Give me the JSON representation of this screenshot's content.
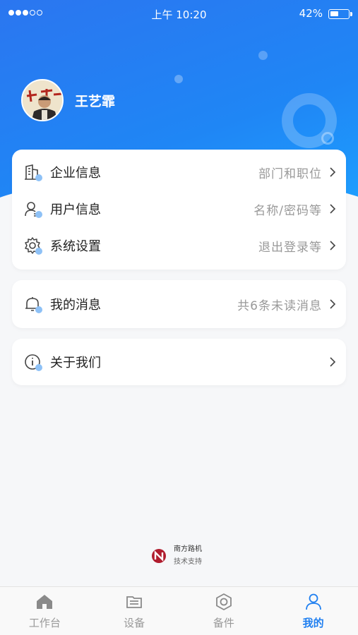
{
  "status_bar": {
    "time": "上午 10:20",
    "battery": "42%"
  },
  "profile": {
    "name": "王艺霏"
  },
  "menu_group1": [
    {
      "label": "企业信息",
      "hint": "部门和职位",
      "icon": "building-icon"
    },
    {
      "label": "用户信息",
      "hint": "名称/密码等",
      "icon": "user-icon"
    },
    {
      "label": "系统设置",
      "hint": "退出登录等",
      "icon": "gear-icon"
    }
  ],
  "menu_group2": [
    {
      "label": "我的消息",
      "hint": "共6条未读消息",
      "icon": "bell-icon"
    }
  ],
  "menu_group3": [
    {
      "label": "关于我们",
      "hint": "",
      "icon": "info-icon"
    }
  ],
  "brand": {
    "name": "南方路机",
    "sub": "技术支持"
  },
  "tabbar": [
    {
      "label": "工作台",
      "icon": "home-icon",
      "active": false
    },
    {
      "label": "设备",
      "icon": "device-icon",
      "active": false
    },
    {
      "label": "备件",
      "icon": "nut-icon",
      "active": false
    },
    {
      "label": "我的",
      "icon": "person-icon",
      "active": true
    }
  ],
  "colors": {
    "accent": "#1f7ff0",
    "header": "#2b76f0",
    "icon_dot": "#8ec1f6"
  }
}
